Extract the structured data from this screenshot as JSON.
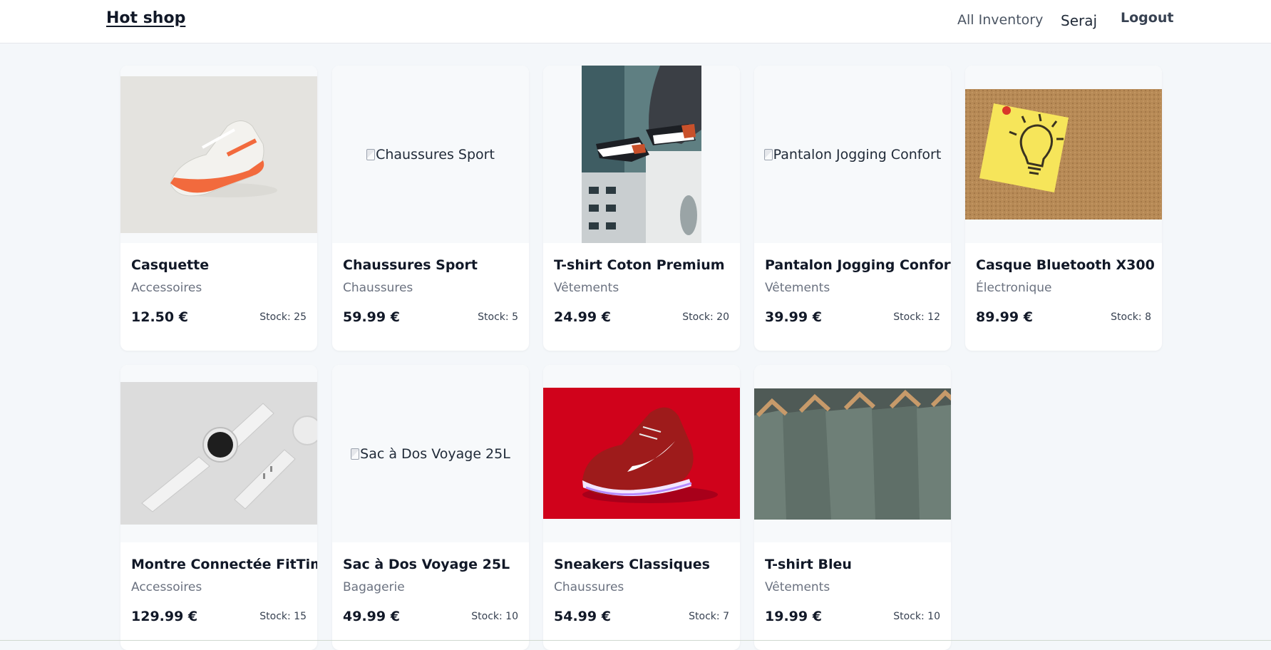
{
  "header": {
    "brand": "Hot shop",
    "nav_inventory": "All Inventory",
    "nav_user": "Seraj",
    "nav_logout": "Logout"
  },
  "products": [
    {
      "name": "Casquette",
      "category": "Accessoires",
      "price": "12.50 €",
      "stock": "Stock: 25",
      "image": "orange-sneaker-photo"
    },
    {
      "name": "Chaussures Sport",
      "category": "Chaussures",
      "price": "59.99 €",
      "stock": "Stock: 5",
      "image_alt": "Chaussures Sport"
    },
    {
      "name": "T-shirt Coton Premium",
      "category": "Vêtements",
      "price": "24.99 €",
      "stock": "Stock: 20",
      "image": "legs-sneakers-building-photo"
    },
    {
      "name": "Pantalon Jogging Confort",
      "category": "Vêtements",
      "price": "39.99 €",
      "stock": "Stock: 12",
      "image_alt": "Pantalon Jogging Confort"
    },
    {
      "name": "Casque Bluetooth X300",
      "category": "Électronique",
      "price": "89.99 €",
      "stock": "Stock: 8",
      "image": "sticky-note-lightbulb-photo"
    },
    {
      "name": "Montre Connectée FitTime",
      "category": "Accessoires",
      "price": "129.99 €",
      "stock": "Stock: 15",
      "image": "smartwatch-photo"
    },
    {
      "name": "Sac à Dos Voyage 25L",
      "category": "Bagagerie",
      "price": "49.99 €",
      "stock": "Stock: 10",
      "image_alt": "Sac à Dos Voyage 25L"
    },
    {
      "name": "Sneakers Classiques",
      "category": "Chaussures",
      "price": "54.99 €",
      "stock": "Stock: 7",
      "image": "red-sneaker-photo"
    },
    {
      "name": "T-shirt Bleu",
      "category": "Vêtements",
      "price": "19.99 €",
      "stock": "Stock: 10",
      "image": "tshirts-on-hangers-photo"
    }
  ]
}
